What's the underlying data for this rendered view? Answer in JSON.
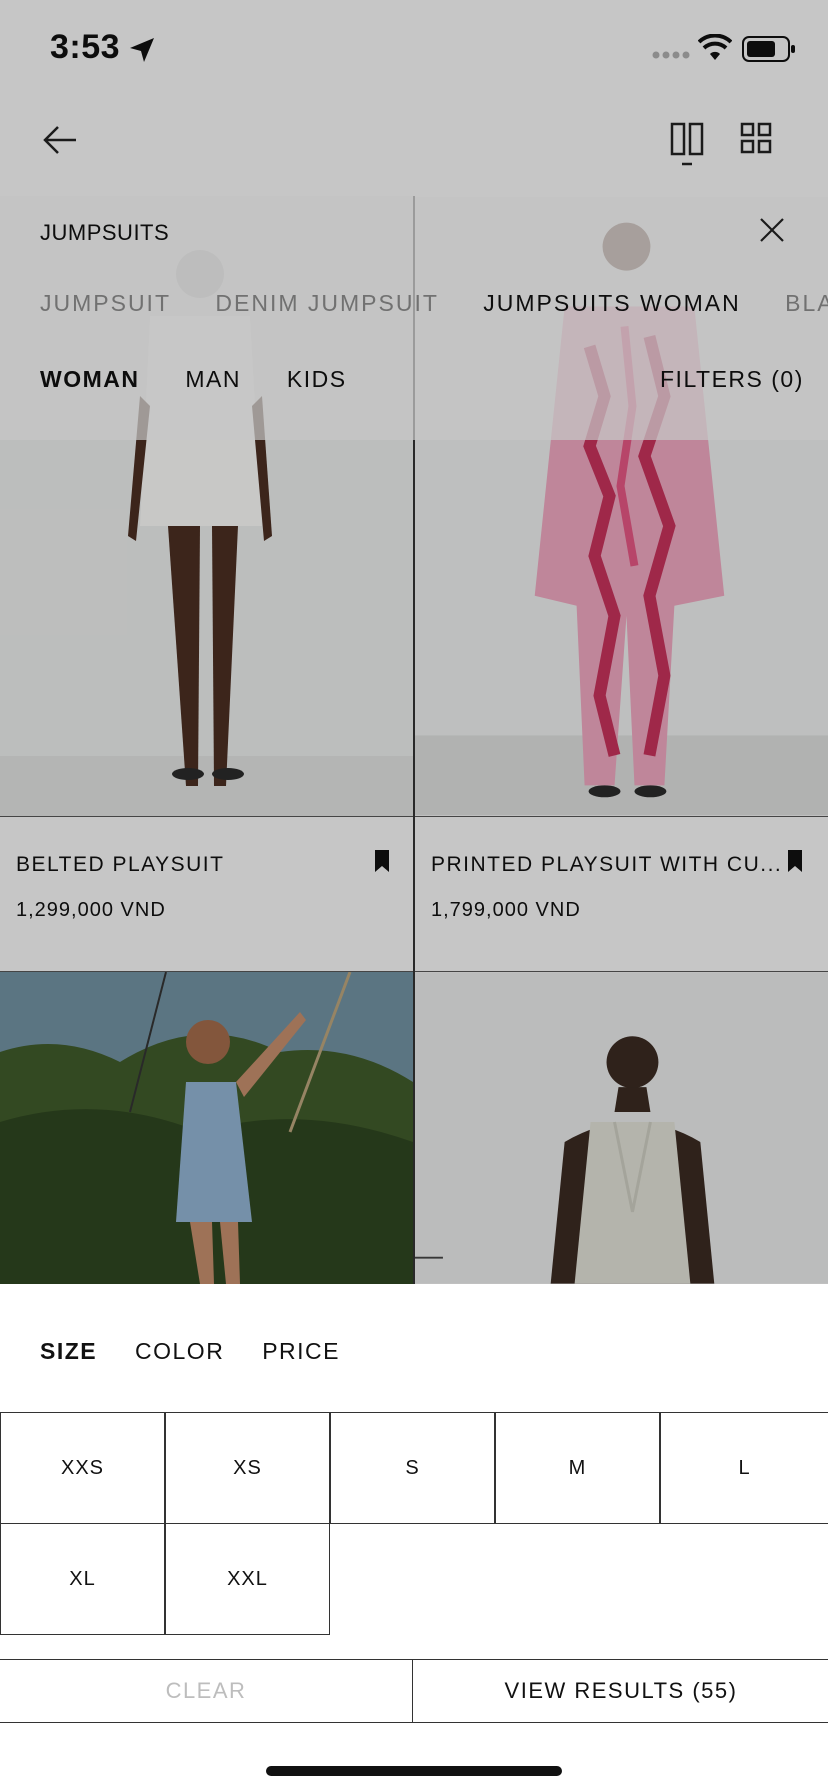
{
  "status": {
    "time": "3:53"
  },
  "search": {
    "query": "JUMPSUITS",
    "suggestions": [
      "JUMPSUIT",
      "DENIM JUMPSUIT",
      "JUMPSUITS WOMAN",
      "BLACK JU"
    ],
    "gender_tabs": [
      "WOMAN",
      "MAN",
      "KIDS"
    ],
    "filters_label": "FILTERS (0)"
  },
  "products": [
    {
      "name": "BELTED PLAYSUIT",
      "price": "1,299,000 VND"
    },
    {
      "name": "PRINTED PLAYSUIT WITH CU...",
      "price": "1,799,000 VND"
    }
  ],
  "sheet": {
    "tabs": [
      "SIZE",
      "COLOR",
      "PRICE"
    ],
    "sizes": [
      "XXS",
      "XS",
      "S",
      "M",
      "L",
      "XL",
      "XXL"
    ],
    "clear_label": "CLEAR",
    "view_results_label": "VIEW RESULTS (55)"
  },
  "colors": {
    "sheet_bg": "#ffffff",
    "page_bg": "#f2f2f2",
    "clear_disabled": "#bdbdbd",
    "text": "#111111"
  },
  "icons": [
    "location-arrow-icon",
    "signal-icon",
    "wifi-icon",
    "battery-icon",
    "back-arrow-icon",
    "grid-two-column-icon",
    "grid-four-column-icon",
    "close-icon",
    "bookmark-icon"
  ]
}
